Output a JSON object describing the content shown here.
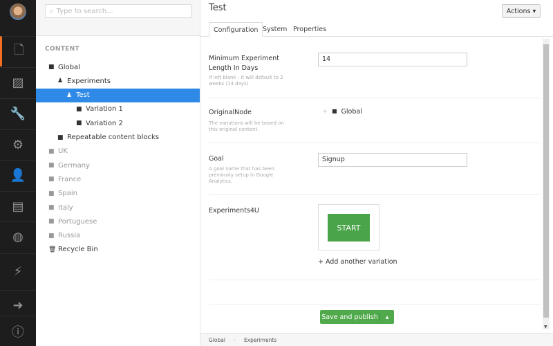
{
  "sidebar": {
    "items": [
      "content",
      "media",
      "settings",
      "developer",
      "users",
      "members",
      "translation",
      "experiments",
      "deploy",
      "help"
    ],
    "active_color": "#f36f21"
  },
  "tree": {
    "search_placeholder": "Type to search...",
    "section_title": "CONTENT",
    "items": [
      {
        "label": "Global",
        "icon": "folder-icon"
      },
      {
        "label": "Experiments",
        "icon": "flask-icon"
      },
      {
        "label": "Test",
        "icon": "flask-icon",
        "selected": true
      },
      {
        "label": "Variation 1",
        "icon": "folder-icon"
      },
      {
        "label": "Variation 2",
        "icon": "folder-icon"
      },
      {
        "label": "Repeatable content blocks",
        "icon": "folder-icon"
      },
      {
        "label": "UK",
        "icon": "folder-icon"
      },
      {
        "label": "Germany",
        "icon": "folder-icon"
      },
      {
        "label": "France",
        "icon": "folder-icon"
      },
      {
        "label": "Spain",
        "icon": "folder-icon"
      },
      {
        "label": "Italy",
        "icon": "folder-icon"
      },
      {
        "label": "Portuguese",
        "icon": "folder-icon"
      },
      {
        "label": "Russia",
        "icon": "folder-icon"
      },
      {
        "label": "Recycle Bin",
        "icon": "trash-icon"
      }
    ]
  },
  "main": {
    "title": "Test",
    "actions_label": "Actions ▾",
    "tabs": [
      "Configuration",
      "System",
      "Properties"
    ],
    "fields": {
      "min_length": {
        "label": "Minimum Experiment Length In Days",
        "description": "If left blank - it will default to 2 weeks (14 days)",
        "value": "14"
      },
      "original_node": {
        "label": "OriginalNode",
        "description": "The variations will be based on this original content.",
        "value": "Global"
      },
      "goal": {
        "label": "Goal",
        "description": "A goal name that has been previously setup in Google Analytics.",
        "value": "Signup"
      },
      "experiments": {
        "label": "Experiments4U",
        "start_label": "START",
        "add_label": "+ Add another variation"
      }
    },
    "save_label": "Save and publish",
    "breadcrumb": [
      "Global",
      "Experiments"
    ]
  },
  "colors": {
    "selected": "#2e8ae6",
    "save": "#50a94b",
    "start": "#4aa44a"
  }
}
